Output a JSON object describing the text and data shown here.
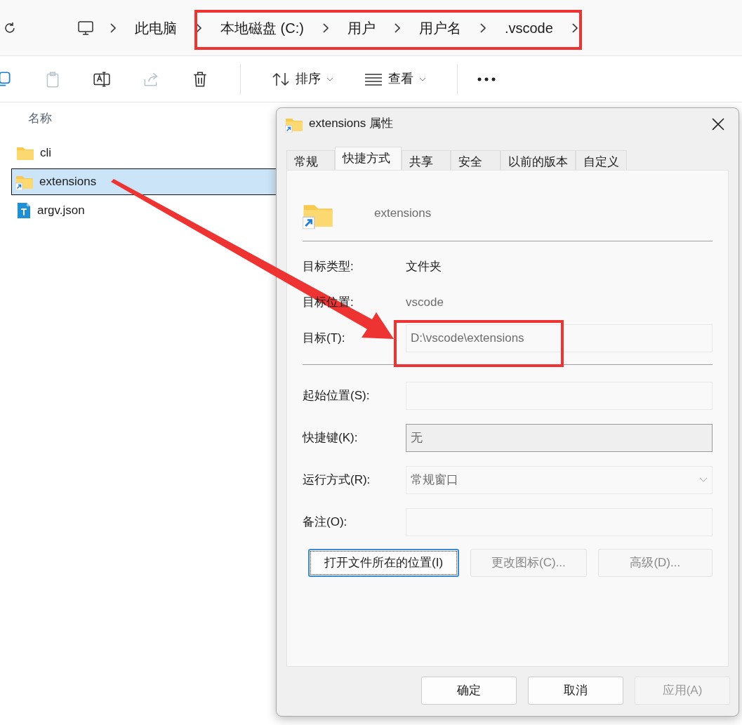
{
  "address_bar": {
    "path": [
      {
        "label": "此电脑"
      },
      {
        "label": "本地磁盘 (C:)"
      },
      {
        "label": "用户"
      },
      {
        "label": "用户名"
      },
      {
        "label": ".vscode"
      }
    ]
  },
  "toolbar": {
    "buttons": [
      {
        "kind": "copy",
        "disabled": false
      },
      {
        "kind": "paste",
        "disabled": true
      },
      {
        "kind": "rename",
        "disabled": false
      },
      {
        "kind": "share",
        "disabled": true
      },
      {
        "kind": "delete",
        "disabled": false
      }
    ],
    "sort": {
      "label": "排序"
    },
    "view": {
      "label": "查看"
    }
  },
  "file_list": {
    "column": "名称",
    "files": [
      {
        "name": "cli",
        "kind": "folder",
        "selected": false
      },
      {
        "name": "extensions",
        "kind": "shortcut",
        "selected": true
      },
      {
        "name": "argv.json",
        "kind": "text",
        "selected": false
      }
    ]
  },
  "dialog": {
    "title": "extensions 属性",
    "tabs": [
      {
        "label": "常规",
        "selected": false
      },
      {
        "label": "快捷方式",
        "selected": true
      },
      {
        "label": "共享",
        "selected": false
      },
      {
        "label": "安全",
        "selected": false
      },
      {
        "label": "以前的版本",
        "selected": false
      },
      {
        "label": "自定义",
        "selected": false
      }
    ],
    "name": "extensions",
    "target_rows": [
      {
        "label": "目标类型:",
        "value": "文件夹",
        "kind": "text",
        "disabled": false
      },
      {
        "label": "目标位置:",
        "value": "vscode",
        "kind": "text",
        "disabled": true
      },
      {
        "label": "目标(T):",
        "value": "D:\\vscode\\extensions",
        "kind": "field",
        "disabled": true
      }
    ],
    "option_rows": [
      {
        "label": "起始位置(S):",
        "kind": "field"
      },
      {
        "label": "快捷键(K):",
        "value": "无",
        "kind": "hotkey",
        "disabled": true
      },
      {
        "label": "运行方式(R):",
        "value": "常规窗口",
        "kind": "select",
        "disabled": true
      },
      {
        "label": "备注(O):",
        "kind": "field"
      }
    ],
    "action_buttons": [
      {
        "label": "打开文件所在的位置(I)",
        "disabled": false
      },
      {
        "label": "更改图标(C)...",
        "disabled": true
      },
      {
        "label": "高级(D)...",
        "disabled": true
      }
    ],
    "footer_buttons": [
      {
        "label": "确定",
        "disabled": false
      },
      {
        "label": "取消",
        "disabled": false
      },
      {
        "label": "应用(A)",
        "disabled": true
      }
    ]
  }
}
